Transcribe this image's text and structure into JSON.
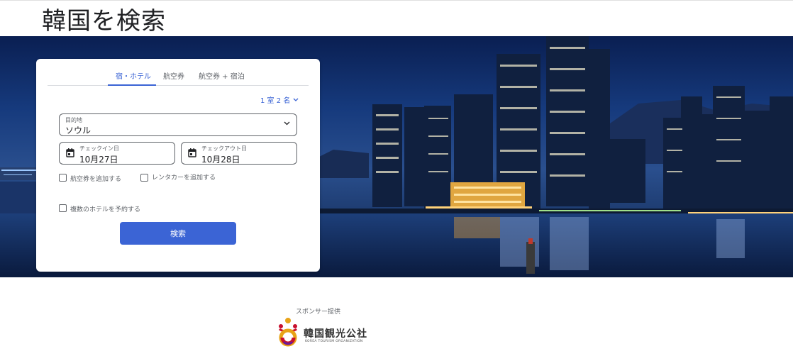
{
  "page": {
    "title": "韓国を検索"
  },
  "search_card": {
    "tabs": [
      {
        "label": "宿・ホテル",
        "active": true
      },
      {
        "label": "航空券",
        "active": false
      },
      {
        "label": "航空券 + 宿泊",
        "active": false
      }
    ],
    "guests": {
      "label": "1 室 2 名"
    },
    "destination": {
      "label": "目的地",
      "value": "ソウル"
    },
    "check_in": {
      "label": "チェックイン日",
      "value": "10月27日"
    },
    "check_out": {
      "label": "チェックアウト日",
      "value": "10月28日"
    },
    "options": {
      "add_flight": "航空券を追加する",
      "add_car": "レンタカーを追加する",
      "multi_hotel": "複数のホテルを予約する"
    },
    "search_button": "検索"
  },
  "sponsor": {
    "label": "スポンサー提供",
    "logo_text": "韓国観光公社",
    "logo_subtext": "KOREA TOURISM ORGANIZATION"
  },
  "colors": {
    "accent": "#3b64d5",
    "text": "#202124",
    "muted": "#5f6368"
  }
}
